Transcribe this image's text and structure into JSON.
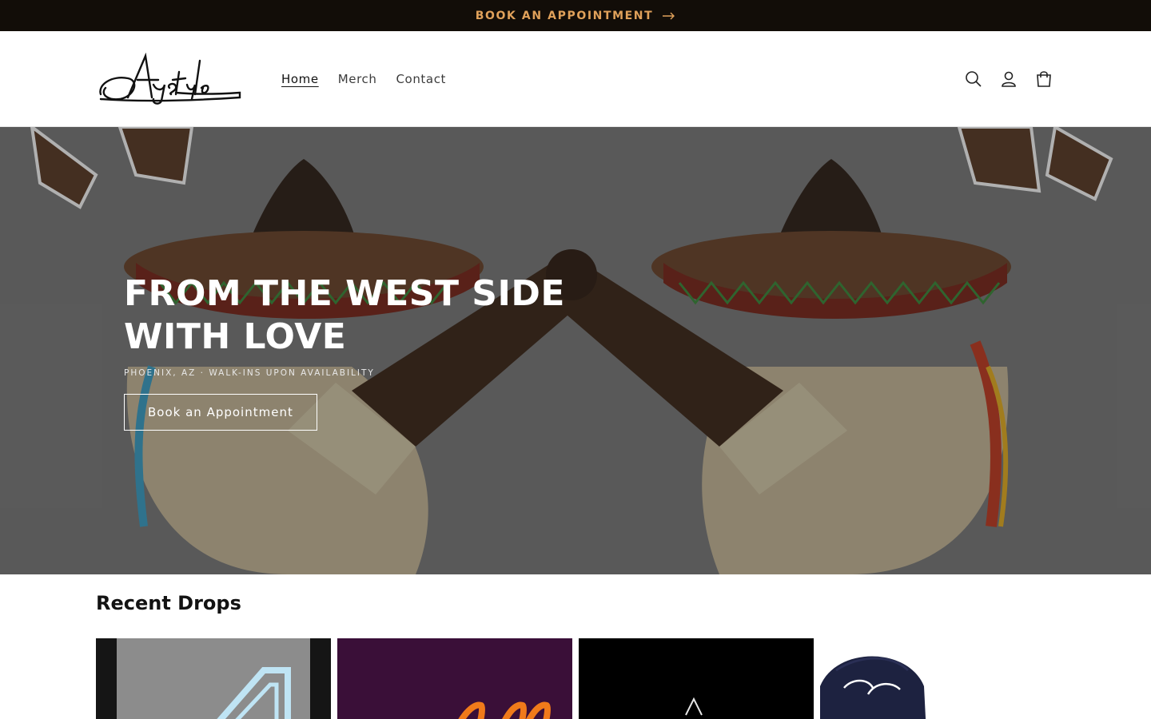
{
  "announcement": {
    "text": "BOOK AN APPOINTMENT",
    "arrow_icon": "arrow-right-icon",
    "background": "#120d08",
    "color": "#e0a15a"
  },
  "header": {
    "logo_text": "Aystyle",
    "nav": [
      {
        "label": "Home",
        "active": true
      },
      {
        "label": "Merch",
        "active": false
      },
      {
        "label": "Contact",
        "active": false
      }
    ],
    "icons": [
      "search-icon",
      "account-icon",
      "cart-icon"
    ]
  },
  "hero": {
    "title": "FROM THE WEST SIDE WITH LOVE",
    "subtitle": "PHOENIX, AZ · WALK-INS UPON AVAILABILITY",
    "button_label": "Book an Appointment"
  },
  "recent_drops": {
    "title": "Recent Drops",
    "products": [
      {
        "name": "product-1",
        "background": "#8c8c8c"
      },
      {
        "name": "product-2",
        "background": "#3a0f38"
      },
      {
        "name": "product-3",
        "background": "#000000"
      },
      {
        "name": "product-4-cap",
        "background": "#ffffff"
      }
    ]
  }
}
